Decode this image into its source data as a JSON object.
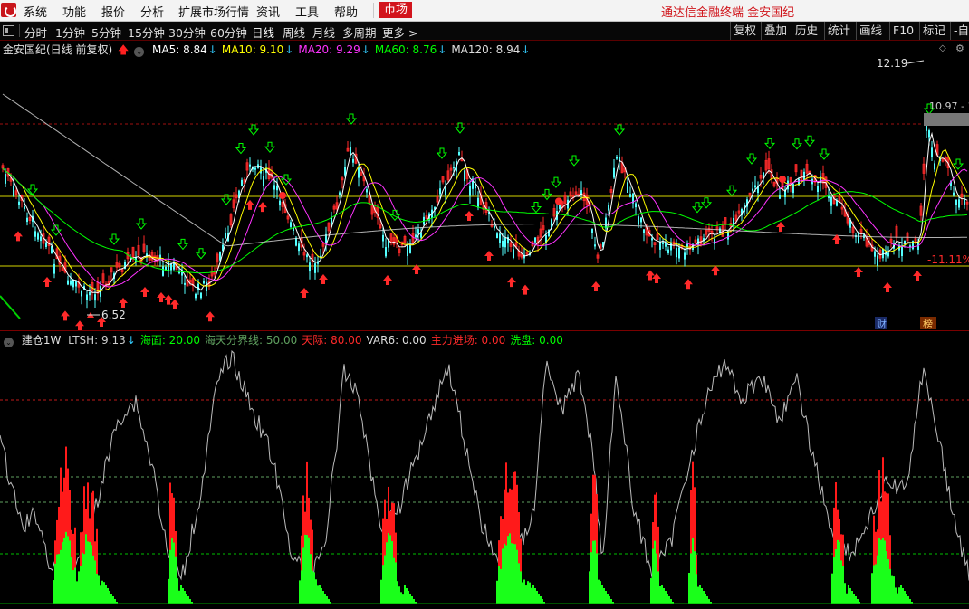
{
  "menu": {
    "items": [
      "系统",
      "功能",
      "报价",
      "分析",
      "扩展市场行情",
      "资讯",
      "工具",
      "帮助"
    ],
    "market_label": "市场",
    "app_title": "通达信金融终端  金安国纪"
  },
  "toolbar": {
    "periods": [
      "分时",
      "1分钟",
      "5分钟",
      "15分钟",
      "30分钟",
      "60分钟",
      "日线",
      "周线",
      "月线",
      "多周期",
      "更多 >"
    ],
    "active_period": "日线",
    "right_buttons": [
      "复权",
      "叠加",
      "历史",
      "统计",
      "画线",
      "F10",
      "标记",
      "-自"
    ]
  },
  "main_legend": {
    "stock": "金安国纪(日线 前复权)",
    "indicators": [
      {
        "label": "MA5: 8.84",
        "color": "#ffffff",
        "dir": "↓"
      },
      {
        "label": "MA10: 9.10",
        "color": "#ffff00",
        "dir": "↓"
      },
      {
        "label": "MA20: 9.29",
        "color": "#ff33ff",
        "dir": "↓"
      },
      {
        "label": "MA60: 8.76",
        "color": "#00ff00",
        "dir": "↓"
      },
      {
        "label": "MA120: 8.94",
        "color": "#dddddd",
        "dir": "↓"
      }
    ]
  },
  "price_annotations": {
    "high": "12.19",
    "high_label": "10.97 - 1",
    "low": "6.52",
    "pct": "-11.11%",
    "badge_fin": "财",
    "badge_rank": "榜"
  },
  "sub_legend": {
    "name": "建仓1W",
    "items": [
      {
        "label": "LTSH: 9.13",
        "color": "#cccccc",
        "dir": "↓"
      },
      {
        "label": "海面: 20.00",
        "color": "#00ff00",
        "dir": ""
      },
      {
        "label": "海天分界线: 50.00",
        "color": "#5fa05f",
        "dir": ""
      },
      {
        "label": "天际: 80.00",
        "color": "#ff2a2a",
        "dir": ""
      },
      {
        "label": "VAR6: 0.00",
        "color": "#dddddd",
        "dir": ""
      },
      {
        "label": "主力进场: 0.00",
        "color": "#ff2a2a",
        "dir": ""
      },
      {
        "label": "洗盘: 0.00",
        "color": "#00ff00",
        "dir": ""
      }
    ]
  },
  "colors": {
    "up": "#ff2a2a",
    "down": "#54ffff",
    "ma5": "#ffffff",
    "ma10": "#ffff00",
    "ma20": "#ff33ff",
    "ma60": "#00ff00",
    "ma120": "#dddddd",
    "menu_accent": "#d2141c"
  }
}
